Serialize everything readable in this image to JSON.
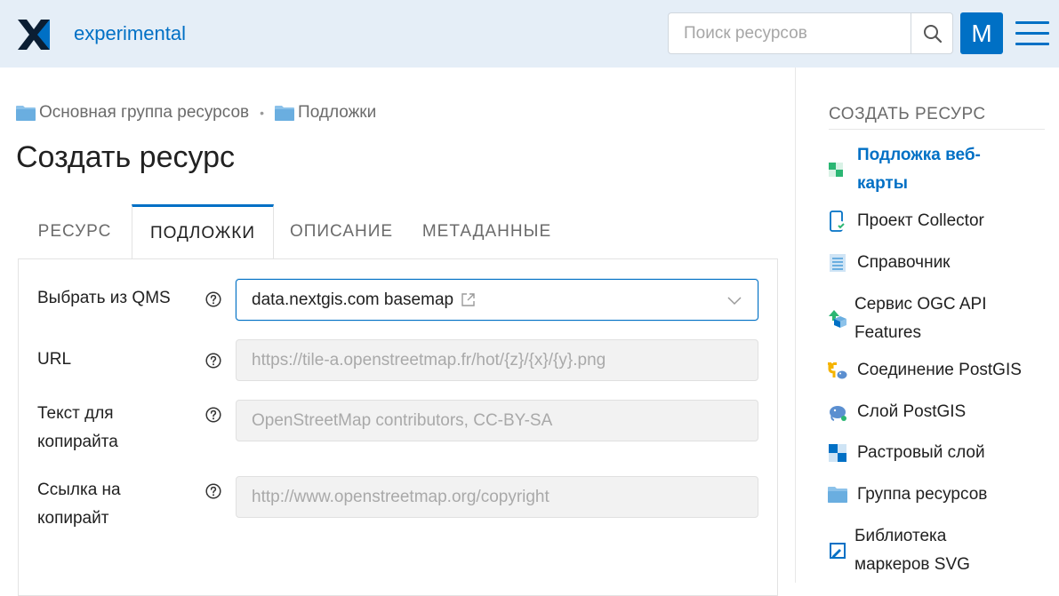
{
  "header": {
    "app_title": "experimental",
    "search_placeholder": "Поиск ресурсов",
    "avatar_letter": "M"
  },
  "breadcrumb": [
    {
      "label": "Основная группа ресурсов"
    },
    {
      "label": "Подложки"
    }
  ],
  "page_title": "Создать ресурс",
  "tabs": [
    {
      "label": "РЕСУРС"
    },
    {
      "label": "ПОДЛОЖКИ"
    },
    {
      "label": "ОПИСАНИЕ"
    },
    {
      "label": "МЕТАДАННЫЕ"
    }
  ],
  "form": {
    "qms": {
      "label": "Выбрать из QMS",
      "value": "data.nextgis.com basemap"
    },
    "url": {
      "label": "URL",
      "value": "https://tile-a.openstreetmap.fr/hot/{z}/{x}/{y}.png"
    },
    "copyright_text": {
      "label_1": "Текст для",
      "label_2": "копирайта",
      "value": "OpenStreetMap contributors, CC-BY-SA"
    },
    "copyright_url": {
      "label_1": "Ссылка на",
      "label_2": "копирайт",
      "value": "http://www.openstreetmap.org/copyright"
    }
  },
  "sidebar": {
    "title": "СОЗДАТЬ РЕСУРС",
    "items": [
      {
        "label_1": "Подложка веб-",
        "label_2": "карты",
        "icon": "basemap-icon"
      },
      {
        "label_1": "Проект Collector",
        "icon": "collector-icon"
      },
      {
        "label_1": "Справочник",
        "icon": "lookup-table-icon"
      },
      {
        "label_1": "Сервис OGC API",
        "label_2": "Features",
        "icon": "ogc-api-icon"
      },
      {
        "label_1": "Соединение PostGIS",
        "icon": "postgis-connection-icon"
      },
      {
        "label_1": "Слой PostGIS",
        "icon": "postgis-layer-icon"
      },
      {
        "label_1": "Растровый слой",
        "icon": "raster-layer-icon"
      },
      {
        "label_1": "Группа ресурсов",
        "icon": "folder-icon"
      },
      {
        "label_1": "Библиотека",
        "label_2": "маркеров SVG",
        "icon": "svg-library-icon"
      }
    ]
  },
  "colors": {
    "accent": "#0070c5",
    "header_bg": "#e5eef7"
  }
}
